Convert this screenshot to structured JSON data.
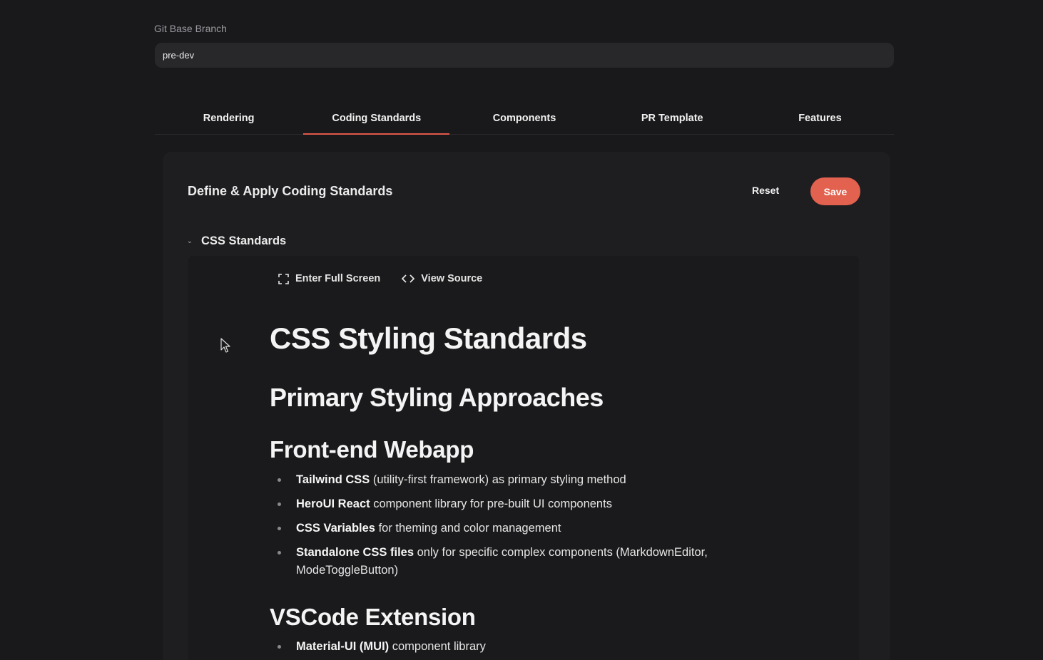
{
  "git": {
    "label": "Git Base Branch",
    "value": "pre-dev"
  },
  "tabs": [
    {
      "label": "Rendering",
      "active": false
    },
    {
      "label": "Coding Standards",
      "active": true
    },
    {
      "label": "Components",
      "active": false
    },
    {
      "label": "PR Template",
      "active": false
    },
    {
      "label": "Features",
      "active": false
    }
  ],
  "card": {
    "title": "Define & Apply Coding Standards",
    "reset_label": "Reset",
    "save_label": "Save"
  },
  "section": {
    "label": "CSS Standards",
    "expanded": true,
    "toolbar": {
      "fullscreen_label": "Enter Full Screen",
      "fullscreen_icon": "expand-icon",
      "source_label": "View Source",
      "source_icon": "code-icon"
    }
  },
  "document": {
    "h1": "CSS Styling Standards",
    "h2": "Primary Styling Approaches",
    "webapp": {
      "heading": "Front-end Webapp",
      "items": [
        {
          "bold": "Tailwind CSS",
          "text": " (utility-first framework) as primary styling method"
        },
        {
          "bold": "HeroUI React",
          "text": " component library for pre-built UI components"
        },
        {
          "bold": "CSS Variables",
          "text": " for theming and color management"
        },
        {
          "bold": "Standalone CSS files",
          "text": " only for specific complex components (MarkdownEditor, ModeToggleButton)"
        }
      ]
    },
    "vscode": {
      "heading": "VSCode Extension",
      "items": [
        {
          "bold": "Material-UI (MUI)",
          "text": " component library"
        }
      ]
    }
  },
  "colors": {
    "accent": "#e2614f",
    "background": "#19191b",
    "card": "#1e1e21"
  }
}
